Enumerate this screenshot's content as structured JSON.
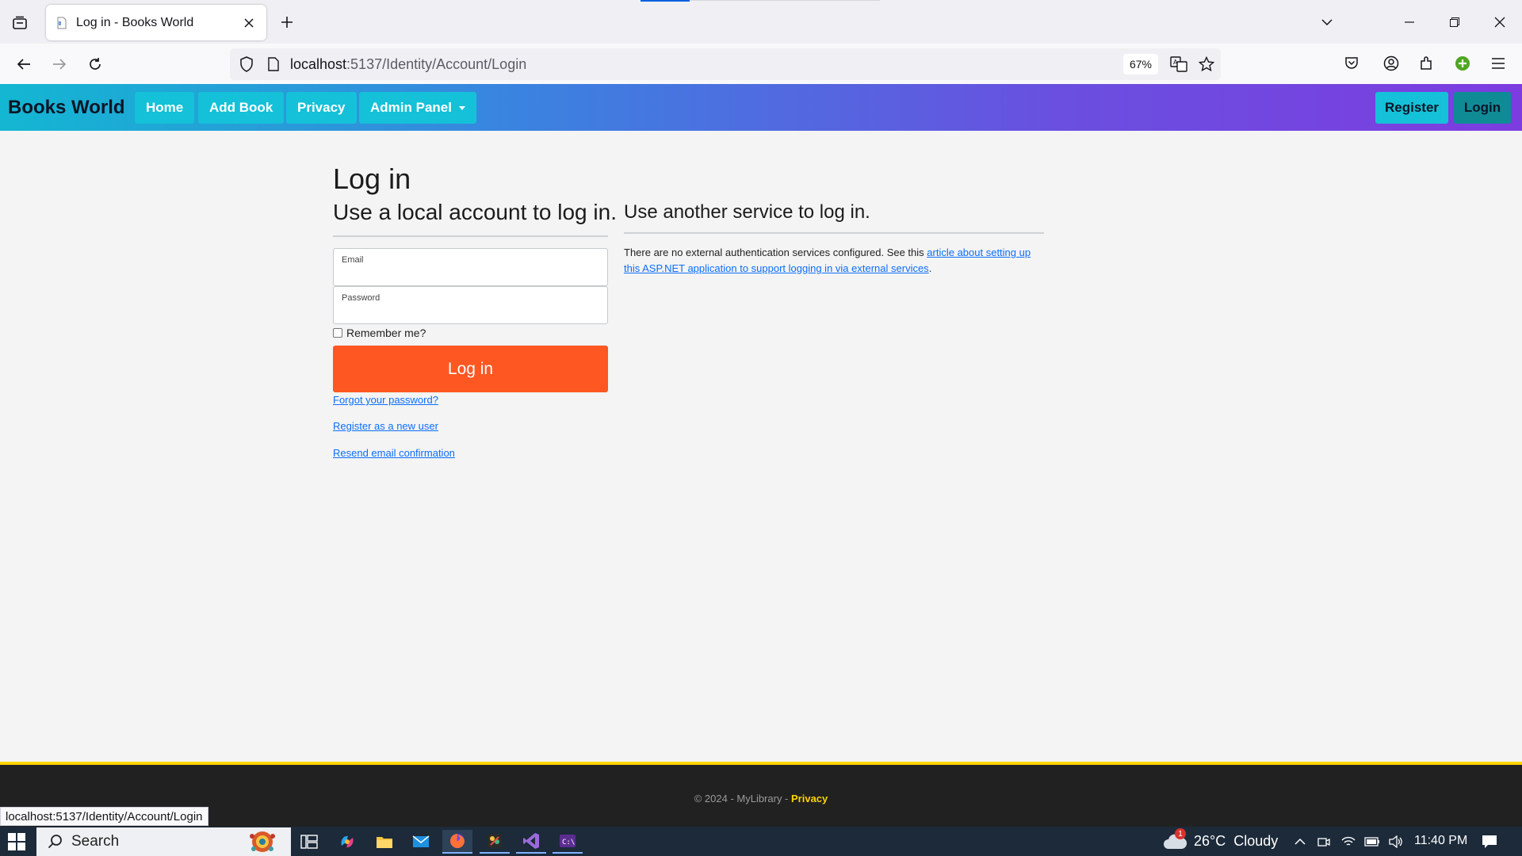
{
  "browser": {
    "tab_title": "Log in - Books World",
    "url_host": "localhost",
    "url_path": ":5137/Identity/Account/Login",
    "zoom": "67%"
  },
  "site": {
    "brand": "Books World",
    "nav": [
      "Home",
      "Add Book",
      "Privacy",
      "Admin Panel"
    ],
    "register_label": "Register",
    "login_label": "Login"
  },
  "login": {
    "title": "Log in",
    "subtitle": "Use a local account to log in.",
    "email_label": "Email",
    "password_label": "Password",
    "remember_label": "Remember me?",
    "submit_label": "Log in",
    "forgot_link": "Forgot your password?",
    "register_link": "Register as a new user",
    "resend_link": "Resend email confirmation"
  },
  "external": {
    "title": "Use another service to log in.",
    "text_before": "There are no external authentication services configured. See this ",
    "link_text": "article about setting up this ASP.NET application to support logging in via external services",
    "text_after": "."
  },
  "footer": {
    "text": "© 2024 - MyLibrary - ",
    "privacy": "Privacy"
  },
  "status_url": "localhost:5137/Identity/Account/Login",
  "taskbar": {
    "search_label": "Search",
    "weather_badge": "1",
    "weather": "26°C  Cloudy",
    "time": "11:40 PM"
  },
  "colors": {
    "submit": "#ff5722",
    "nav_button": "#14c1d8",
    "footer_accent": "#ffd400"
  }
}
